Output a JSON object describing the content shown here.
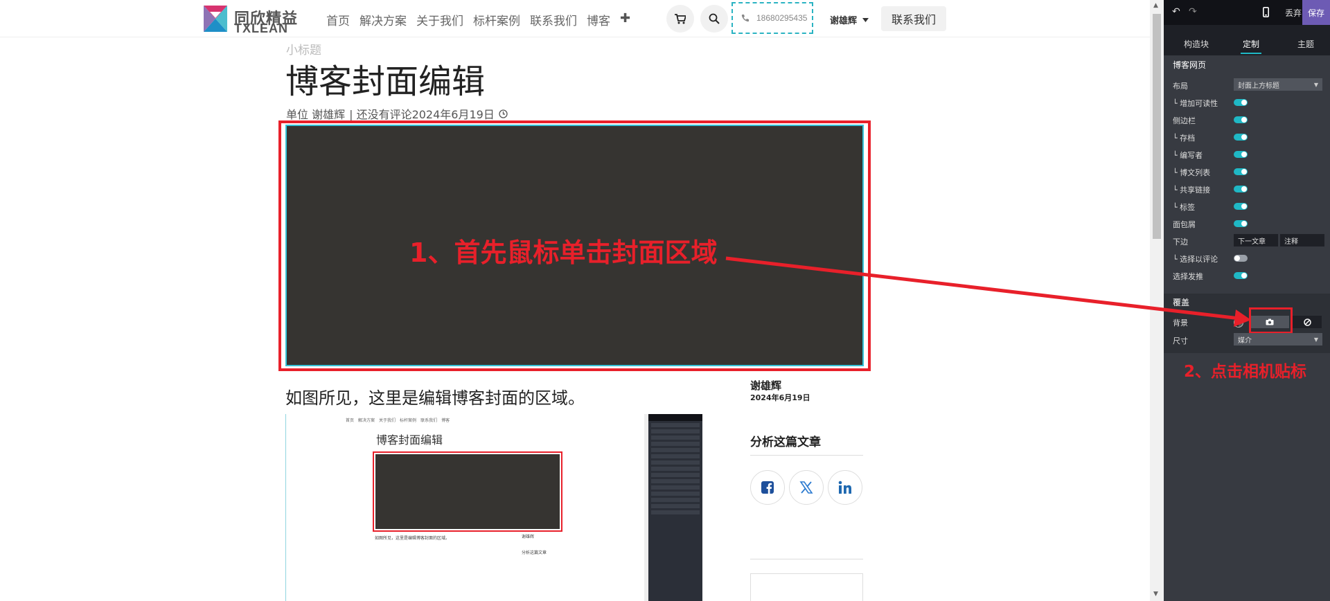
{
  "header": {
    "logo_cn": "同欣精益",
    "logo_en": "TXLEAN",
    "nav": [
      "首页",
      "解决方案",
      "关于我们",
      "标杆案例",
      "联系我们",
      "博客"
    ],
    "nav_plus": "✚",
    "phone": "18680295435",
    "user": "谢雄辉",
    "contact_button": "联系我们"
  },
  "post": {
    "subtitle": "小标题",
    "title": "博客封面编辑",
    "meta_unit": "单位 谢雄辉",
    "meta_info": "| 还没有评论2024年6月19日",
    "annotation1": "1、首先鼠标单击封面区域",
    "paragraph": "如图所见，这里是编辑博客封面的区域。"
  },
  "sidebar": {
    "author": "谢雄辉",
    "date": "2024年6月19日",
    "analyze_title": "分析这篇文章"
  },
  "nested": {
    "nav": [
      "首页",
      "解决方案",
      "关于我们",
      "标杆案例",
      "联系我们",
      "博客"
    ],
    "title": "博客封面编辑",
    "para": "如图所见，这里是编辑博客封面的区域。",
    "side_author": "谢雄辉",
    "side_analyze": "分析这篇文章"
  },
  "panel": {
    "discard": "丢弃",
    "save": "保存",
    "tabs": [
      "构造块",
      "定制",
      "主题"
    ],
    "section_title": "博客网页",
    "layout_label": "布局",
    "layout_value": "封面上方标题",
    "rows": [
      {
        "label": "└ 增加可读性",
        "on": true
      },
      {
        "label": "侧边栏",
        "on": true
      },
      {
        "label": "└ 存档",
        "on": true
      },
      {
        "label": "└ 编写者",
        "on": true
      },
      {
        "label": "└ 博文列表",
        "on": true
      },
      {
        "label": "└ 共享链接",
        "on": true
      },
      {
        "label": "└ 标签",
        "on": true
      },
      {
        "label": "面包屑",
        "on": true
      }
    ],
    "bottom_label": "下边",
    "bottom_next": "下一文章",
    "bottom_comment": "注释",
    "select_comment_label": "└ 选择以评论",
    "select_publish_label": "选择发推",
    "cover_section": "覆盖",
    "bg_label": "背景",
    "size_label": "尺寸",
    "size_value": "媒介",
    "annotation2": "2、点击相机贴标"
  },
  "colors": {
    "accent": "#1fb8c5",
    "annotation": "#e8202a",
    "save_bg": "#6d5bb4",
    "cover_bg": "#363431"
  }
}
